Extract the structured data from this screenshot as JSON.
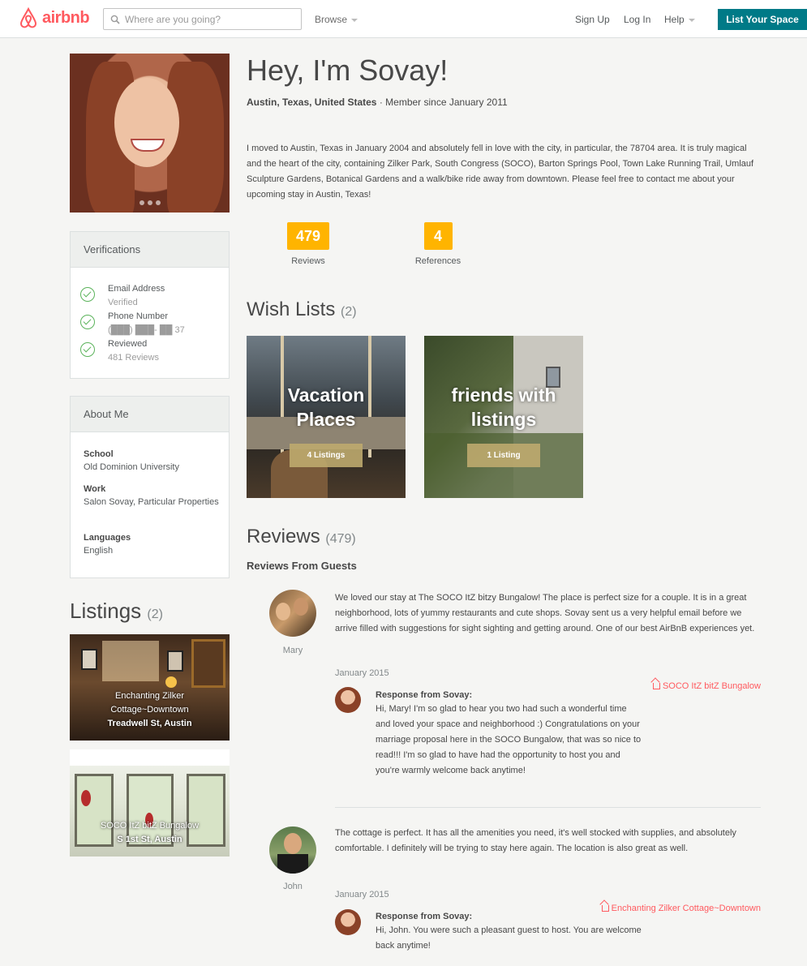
{
  "header": {
    "brand": "airbnb",
    "search_placeholder": "Where are you going?",
    "browse_label": "Browse",
    "signup_label": "Sign Up",
    "login_label": "Log In",
    "help_label": "Help",
    "list_space_label": "List Your Space",
    "brand_color": "#ff5a5f",
    "accent_color": "#007a87"
  },
  "profile": {
    "greeting": "Hey, I'm Sovay!",
    "location": "Austin, Texas, United States",
    "member_since": " · Member since January 2011",
    "bio": "I moved to Austin, Texas in January 2004 and absolutely fell in love with the city, in particular, the 78704 area. It is truly magical and the heart of the city, containing Zilker Park, South Congress (SOCO), Barton Springs Pool, Town Lake Running Trail, Umlauf Sculpture Gardens, Botanical Gardens and a walk/bike ride away from downtown. Please feel free to contact me about your upcoming stay in Austin, Texas!"
  },
  "stats": {
    "reviews_count": "479",
    "reviews_label": "Reviews",
    "references_count": "4",
    "references_label": "References",
    "badge_color": "#ffb400"
  },
  "verifications": {
    "title": "Verifications",
    "items": [
      {
        "title": "Email Address",
        "sub": "Verified"
      },
      {
        "title": "Phone Number",
        "sub": "(███) ███- ██ 37"
      },
      {
        "title": "Reviewed",
        "sub": "481 Reviews"
      }
    ]
  },
  "about": {
    "title": "About Me",
    "items": [
      {
        "key": "School",
        "value": "Old Dominion University"
      },
      {
        "key": "Work",
        "value": "Salon Sovay, Particular Properties"
      },
      {
        "key": "Languages",
        "value": "English"
      }
    ]
  },
  "listings": {
    "title": "Listings",
    "count": "(2)",
    "items": [
      {
        "line1": "Enchanting Zilker",
        "line2": "Cottage~Downtown",
        "line3": "Treadwell St, Austin"
      },
      {
        "line1": "SOCO ItZ bitZ Bungalow",
        "line2": "S 1st St, Austin"
      }
    ]
  },
  "wishlists": {
    "title": "Wish Lists",
    "count": "(2)",
    "items": [
      {
        "line1": "Vacation",
        "line2": "Places",
        "button": "4 Listings"
      },
      {
        "line1": "friends with",
        "line2": "listings",
        "button": "1 Listing"
      }
    ]
  },
  "reviews": {
    "title": "Reviews",
    "count": "(479)",
    "subtitle": "Reviews From Guests",
    "items": [
      {
        "name": "Mary",
        "text": "We loved our stay at The SOCO ItZ bitzy Bungalow! The place is perfect size for a couple. It is in a great neighborhood, lots of yummy restaurants and cute shops. Sovay sent us a very helpful email before we arrive filled with suggestions for sight sighting and getting around. One of our best AirBnB experiences yet.",
        "date": "January 2015",
        "listing": "SOCO ItZ bitZ Bungalow",
        "response_label": "Response from Sovay:",
        "response": "Hi, Mary! I'm so glad to hear you two had such a wonderful time and loved your space and neighborhood :) Congratulations on your marriage proposal here in the SOCO Bungalow, that was so nice to read!!! I'm so glad to have had the opportunity to host you and you're warmly welcome back anytime!"
      },
      {
        "name": "John",
        "text": "The cottage is perfect. It has all the amenities you need, it's well stocked with supplies, and absolutely comfortable. I definitely will be trying to stay here again. The location is also great as well.",
        "date": "January 2015",
        "listing": "Enchanting Zilker Cottage~Downtown",
        "response_label": "Response from Sovay:",
        "response": "Hi, John. You were such a pleasant guest to host. You are welcome back anytime!"
      }
    ]
  }
}
